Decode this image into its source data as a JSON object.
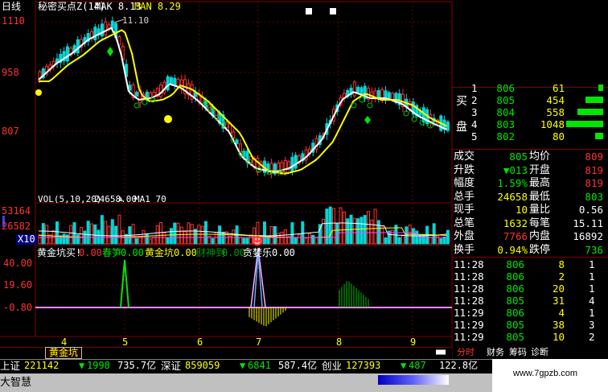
{
  "header": {
    "period": "日线",
    "indicator": "秘密买点Z(14)",
    "ma_a": "MAK 8.13",
    "ma_b": "MAN 8.29"
  },
  "price_axis": [
    "1110",
    "958",
    "807"
  ],
  "annotations": {
    "high": "11.10"
  },
  "volume": {
    "title": "VOL(5,10,20)",
    "value": "24658.00",
    "ma1": "MA1 70",
    "axis": [
      "53164",
      "26582"
    ],
    "scale": "X10"
  },
  "indicator_panel": {
    "items": [
      {
        "label": "黄金坑买!",
        "value": "0.00"
      },
      {
        "label": "春笋",
        "value": "0.00"
      },
      {
        "label": "黄金坑",
        "value": "0.00"
      },
      {
        "label": "财神到",
        "value": "0.00"
      },
      {
        "label": "贪婪乐",
        "value": "0.00"
      }
    ],
    "axis": [
      "40.00",
      "19.60",
      "-0.80"
    ]
  },
  "date_axis": [
    "4",
    "5",
    "6",
    "7",
    "8",
    "9"
  ],
  "order_book": {
    "buy_label": "买",
    "sell_label": "盘",
    "rows": [
      {
        "n": "1",
        "price": "806",
        "vol": "61"
      },
      {
        "n": "2",
        "price": "805",
        "vol": "454"
      },
      {
        "n": "3",
        "price": "804",
        "vol": "558"
      },
      {
        "n": "4",
        "price": "803",
        "vol": "1048"
      },
      {
        "n": "5",
        "price": "802",
        "vol": "80"
      }
    ]
  },
  "quote": [
    {
      "k1": "成交",
      "v1": "805",
      "k2": "均价",
      "v2": "809"
    },
    {
      "k1": "升跌",
      "v1": "▼013",
      "k2": "开盘",
      "v2": "819"
    },
    {
      "k1": "幅度",
      "v1": "1.59%",
      "k2": "最高",
      "v2": "819"
    },
    {
      "k1": "总手",
      "v1": "24658",
      "k2": "最低",
      "v2": "803"
    },
    {
      "k1": "现手",
      "v1": "10",
      "k2": "量比",
      "v2": "0.56"
    },
    {
      "k1": "总笔",
      "v1": "1632",
      "k2": "每笔",
      "v2": "15.11"
    },
    {
      "k1": "外盘",
      "v1": "7766",
      "k2": "内盘",
      "v2": "16892"
    },
    {
      "k1": "换手",
      "v1": "0.94%",
      "k2": "跌停",
      "v2": "736"
    }
  ],
  "ticks": [
    {
      "time": "11:28",
      "price": "806",
      "vol": "8",
      "dir": "1"
    },
    {
      "time": "11:28",
      "price": "806",
      "vol": "2",
      "dir": "1"
    },
    {
      "time": "11:28",
      "price": "806",
      "vol": "20",
      "dir": "1"
    },
    {
      "time": "11:28",
      "price": "805",
      "vol": "31",
      "dir": "4"
    },
    {
      "time": "11:29",
      "price": "806",
      "vol": "4",
      "dir": "1"
    },
    {
      "time": "11:29",
      "price": "805",
      "vol": "38",
      "dir": "3"
    },
    {
      "time": "11:29",
      "price": "805",
      "vol": "10",
      "dir": "2"
    }
  ],
  "tabs": {
    "left": "黄金坑",
    "right": [
      "分时",
      "财务",
      "筹码",
      "诊断"
    ]
  },
  "taskbar": {
    "row1": [
      {
        "name": "上证",
        "v1": "221142",
        "arrow": "▼",
        "v2": "1998",
        "v3": "735.7亿"
      },
      {
        "name": "深证",
        "v1": "859059",
        "arrow": "▼",
        "v2": "6841",
        "v3": "587.4亿"
      },
      {
        "name": "创业",
        "v1": "127393",
        "arrow": "▼",
        "v2": "487",
        "v3": "122.8亿"
      }
    ],
    "row2_left": "大智慧",
    "watermark": "www.7gpzb.com"
  }
}
